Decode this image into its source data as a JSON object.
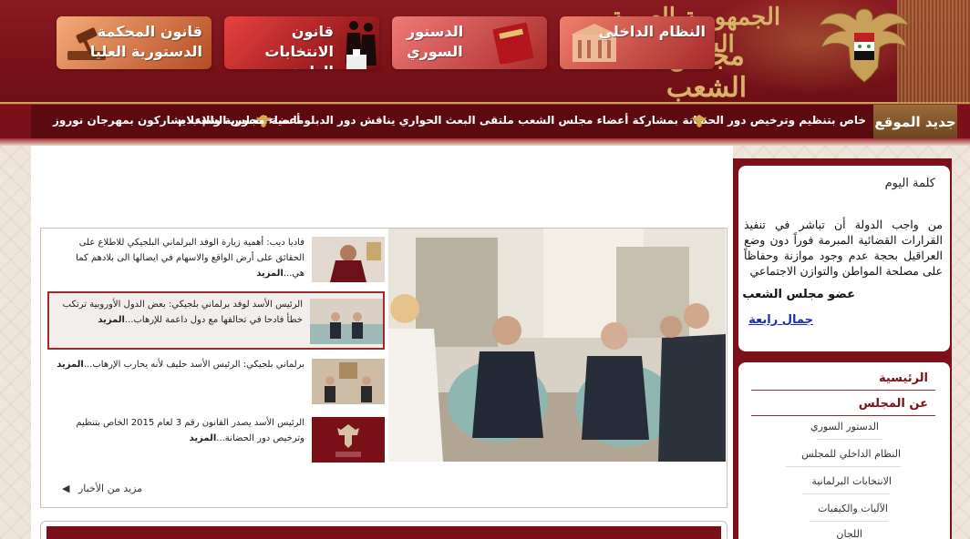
{
  "header": {
    "title_line1": "الجمهورية العربية السورية",
    "title_line2": "مجلس الشعب"
  },
  "ticker": {
    "label": "جديد الموقع",
    "items": [
      "خاص بتنظيم وترخيص دور الحضانة",
      "بمشاركة أعضاء مجلس الشعب ملتقى البعث الحواري يناقش دور الدبلوماسية السورية والإعلام",
      "أعضاء مجلس الشعب يشاركون بمهرجان نوروز"
    ]
  },
  "banners": [
    {
      "label": "النظام الداخلي",
      "color1": "#e56a5a",
      "color2": "#9e2b2b"
    },
    {
      "label": "الدستور السوري",
      "color1": "#e86868",
      "color2": "#a62a2a"
    },
    {
      "label": "قانون الانتخابات العامة",
      "color1": "#e33a3a",
      "color2": "#7a0f12"
    },
    {
      "label": "قانون المحكمة الدستورية العليا",
      "color1": "#f0a070",
      "color2": "#b34a22"
    }
  ],
  "news": [
    {
      "text": "فاديا ديب: أهمية زيارة الوفد البرلماني البلجيكي للاطلاع على الحقائق على أرض الواقع والاسهام في ايصالها الى بلادهم كما هي...",
      "more": "المزيد"
    },
    {
      "text": "الرئيس الأسد لوفد برلماني بلجيكي: بعض الدول الأوروبية ترتكب خطأ فادحا في تحالفها مع دول داعمة للإرهاب...",
      "more": "المزيد"
    },
    {
      "text": "برلماني بلجيكي: الرئيس الأسد حليف لأنه يحارب الإرهاب...",
      "more": "المزيد"
    },
    {
      "text": "الرئيس الأسد يصدر القانون رقم 3 لعام 2015 الخاص بتنظيم وترخيص دور الحضانة...",
      "more": "المزيد"
    }
  ],
  "more_news": "مزيد من الأخبار",
  "word_of_day": {
    "title": "كلمة اليوم",
    "body": "من واجب الدولة أن تباشر في تنفيذ القرارات القضائية المبرمة فوراً دون وضع العراقيل بحجة عدم وجود موازنة وحفاظاً على مصلحة المواطن والتوازن الاجتماعي",
    "member_label": "عضو مجلس الشعب",
    "member_name": "جمال رابعة"
  },
  "menu": {
    "home": "الرئيسية",
    "about": "عن المجلس",
    "items": [
      "الدستور السوري",
      "النظام الداخلي للمجلس",
      "الانتخابات البرلمانية",
      "الآليات والكيفيات",
      "اللجان"
    ]
  }
}
